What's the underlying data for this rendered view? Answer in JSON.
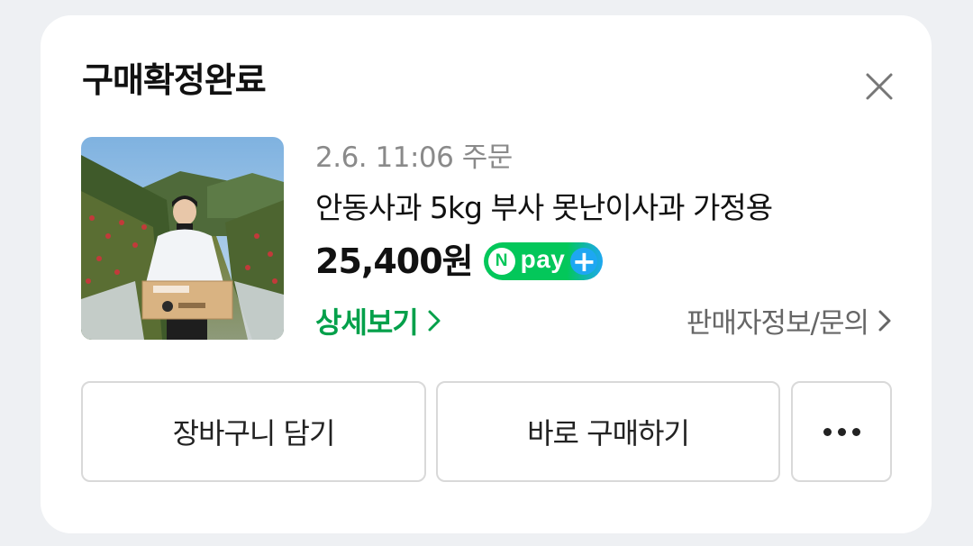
{
  "card": {
    "title": "구매확정완료"
  },
  "order": {
    "meta": "2.6. 11:06 주문",
    "product_name": "안동사과 5kg 부사 못난이사과 가정용",
    "price": "25,400원",
    "npay_badge": {
      "n": "N",
      "text": "pay",
      "plus": "+"
    },
    "detail_link": "상세보기",
    "seller_link": "판매자정보/문의"
  },
  "actions": {
    "cart_label": "장바구니 담기",
    "buy_label": "바로 구매하기",
    "more_icon": "more-horizontal-icon"
  },
  "icons": {
    "close": "close-icon",
    "chevron": "chevron-right-icon"
  },
  "colors": {
    "accent_green": "#03a04a",
    "npay_green": "#03c75a",
    "npay_blue": "#1ea7f2"
  }
}
